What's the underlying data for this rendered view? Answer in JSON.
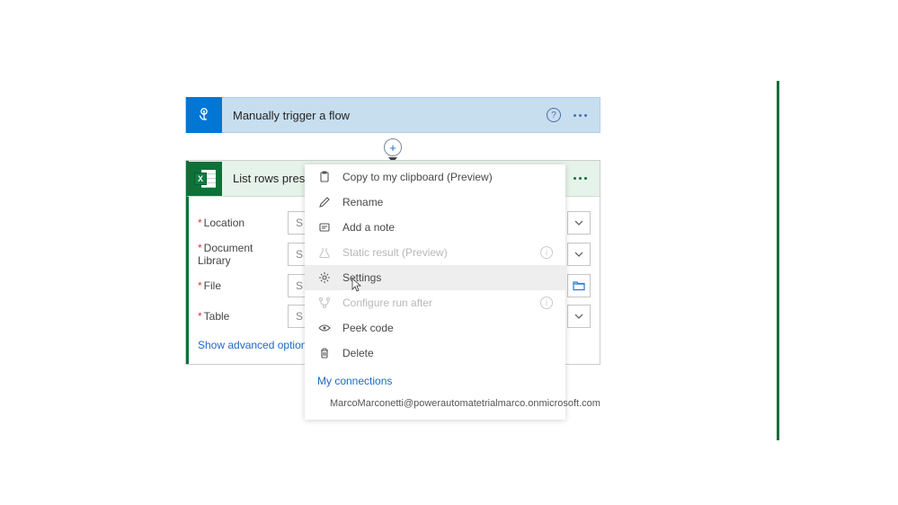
{
  "trigger": {
    "title": "Manually trigger a flow"
  },
  "action": {
    "title": "List rows present",
    "fields": [
      {
        "label": "Location",
        "placeholder": "S"
      },
      {
        "label": "Document Library",
        "placeholder": "S"
      },
      {
        "label": "File",
        "placeholder": "S"
      },
      {
        "label": "Table",
        "placeholder": "S"
      }
    ],
    "advanced_toggle": "Show advanced options"
  },
  "menu": {
    "items": [
      {
        "key": "copy",
        "label": "Copy to my clipboard (Preview)"
      },
      {
        "key": "rename",
        "label": "Rename"
      },
      {
        "key": "addnote",
        "label": "Add a note"
      },
      {
        "key": "static",
        "label": "Static result (Preview)"
      },
      {
        "key": "settings",
        "label": "Settings"
      },
      {
        "key": "runafter",
        "label": "Configure run after"
      },
      {
        "key": "peek",
        "label": "Peek code"
      },
      {
        "key": "delete",
        "label": "Delete"
      }
    ],
    "connections_label": "My connections",
    "connection": "MarcoMarconetti@powerautomatetrialmarco.onmicrosoft.com"
  }
}
